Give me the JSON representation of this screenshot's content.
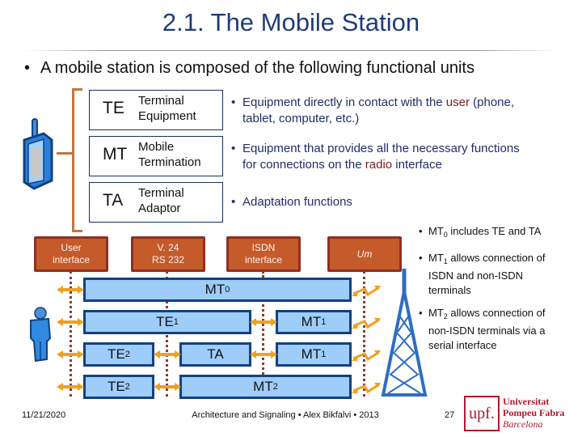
{
  "slide": {
    "title": "2.1. The Mobile Station",
    "main_bullet": "A mobile station is composed of the following functional units"
  },
  "units": [
    {
      "abbr": "TE",
      "name_line1": "Terminal",
      "name_line2": "Equipment",
      "desc_pre": "Equipment directly in contact with the ",
      "desc_hl": "user",
      "desc_post": " (phone,",
      "desc_line2": "tablet, computer, etc.)"
    },
    {
      "abbr": "MT",
      "name_line1": "Mobile",
      "name_line2": "Termination",
      "desc_pre": "Equipment that provides all the necessary functions",
      "desc_hl": "",
      "desc_post": "",
      "desc_line2_pre": "for connections on the ",
      "desc_line2_hl": "radio",
      "desc_line2_post": " interface"
    },
    {
      "abbr": "TA",
      "name_line1": "Terminal",
      "name_line2": "Adaptor",
      "desc_pre": "Adaptation functions"
    }
  ],
  "interfaces": [
    {
      "line1": "User",
      "line2": "interface"
    },
    {
      "line1": "V. 24",
      "line2": "RS 232"
    },
    {
      "line1": "ISDN",
      "line2": "interface"
    },
    {
      "line1": "Um",
      "line2": ""
    }
  ],
  "blocks": {
    "mt0": {
      "base": "MT",
      "sub": "0"
    },
    "te1": {
      "base": "TE",
      "sub": "1"
    },
    "mt1a": {
      "base": "MT",
      "sub": "1"
    },
    "te2a": {
      "base": "TE",
      "sub": "2"
    },
    "ta": {
      "base": "TA",
      "sub": ""
    },
    "mt1b": {
      "base": "MT",
      "sub": "1"
    },
    "te2b": {
      "base": "TE",
      "sub": "2"
    },
    "mt2": {
      "base": "MT",
      "sub": "2"
    }
  },
  "notes": [
    {
      "pre": "MT",
      "sub": "0",
      "post": " includes TE and TA"
    },
    {
      "pre": "MT",
      "sub": "1",
      "post": " allows connection of",
      "line2": "ISDN and non-ISDN",
      "line3": "terminals"
    },
    {
      "pre": "MT",
      "sub": "2",
      "post": " allows connection of",
      "line2": "non-ISDN terminals via a",
      "line3": "serial interface"
    }
  ],
  "footer": {
    "date": "11/21/2020",
    "center": "Architecture and Signaling • Alex Bikfalvi • 2013",
    "page": "27",
    "logo_mark": "upf.",
    "logo_line1": "Universitat",
    "logo_line2": "Pompeu Fabra",
    "logo_line3": "Barcelona"
  },
  "colors": {
    "title": "#1f3b78",
    "interface_fill": "#c55a2a",
    "block_fill": "#9fcdfa",
    "block_border": "#13417d",
    "arrow": "#f0a020",
    "highlight": "#7b2020",
    "logo": "#b0192e"
  }
}
